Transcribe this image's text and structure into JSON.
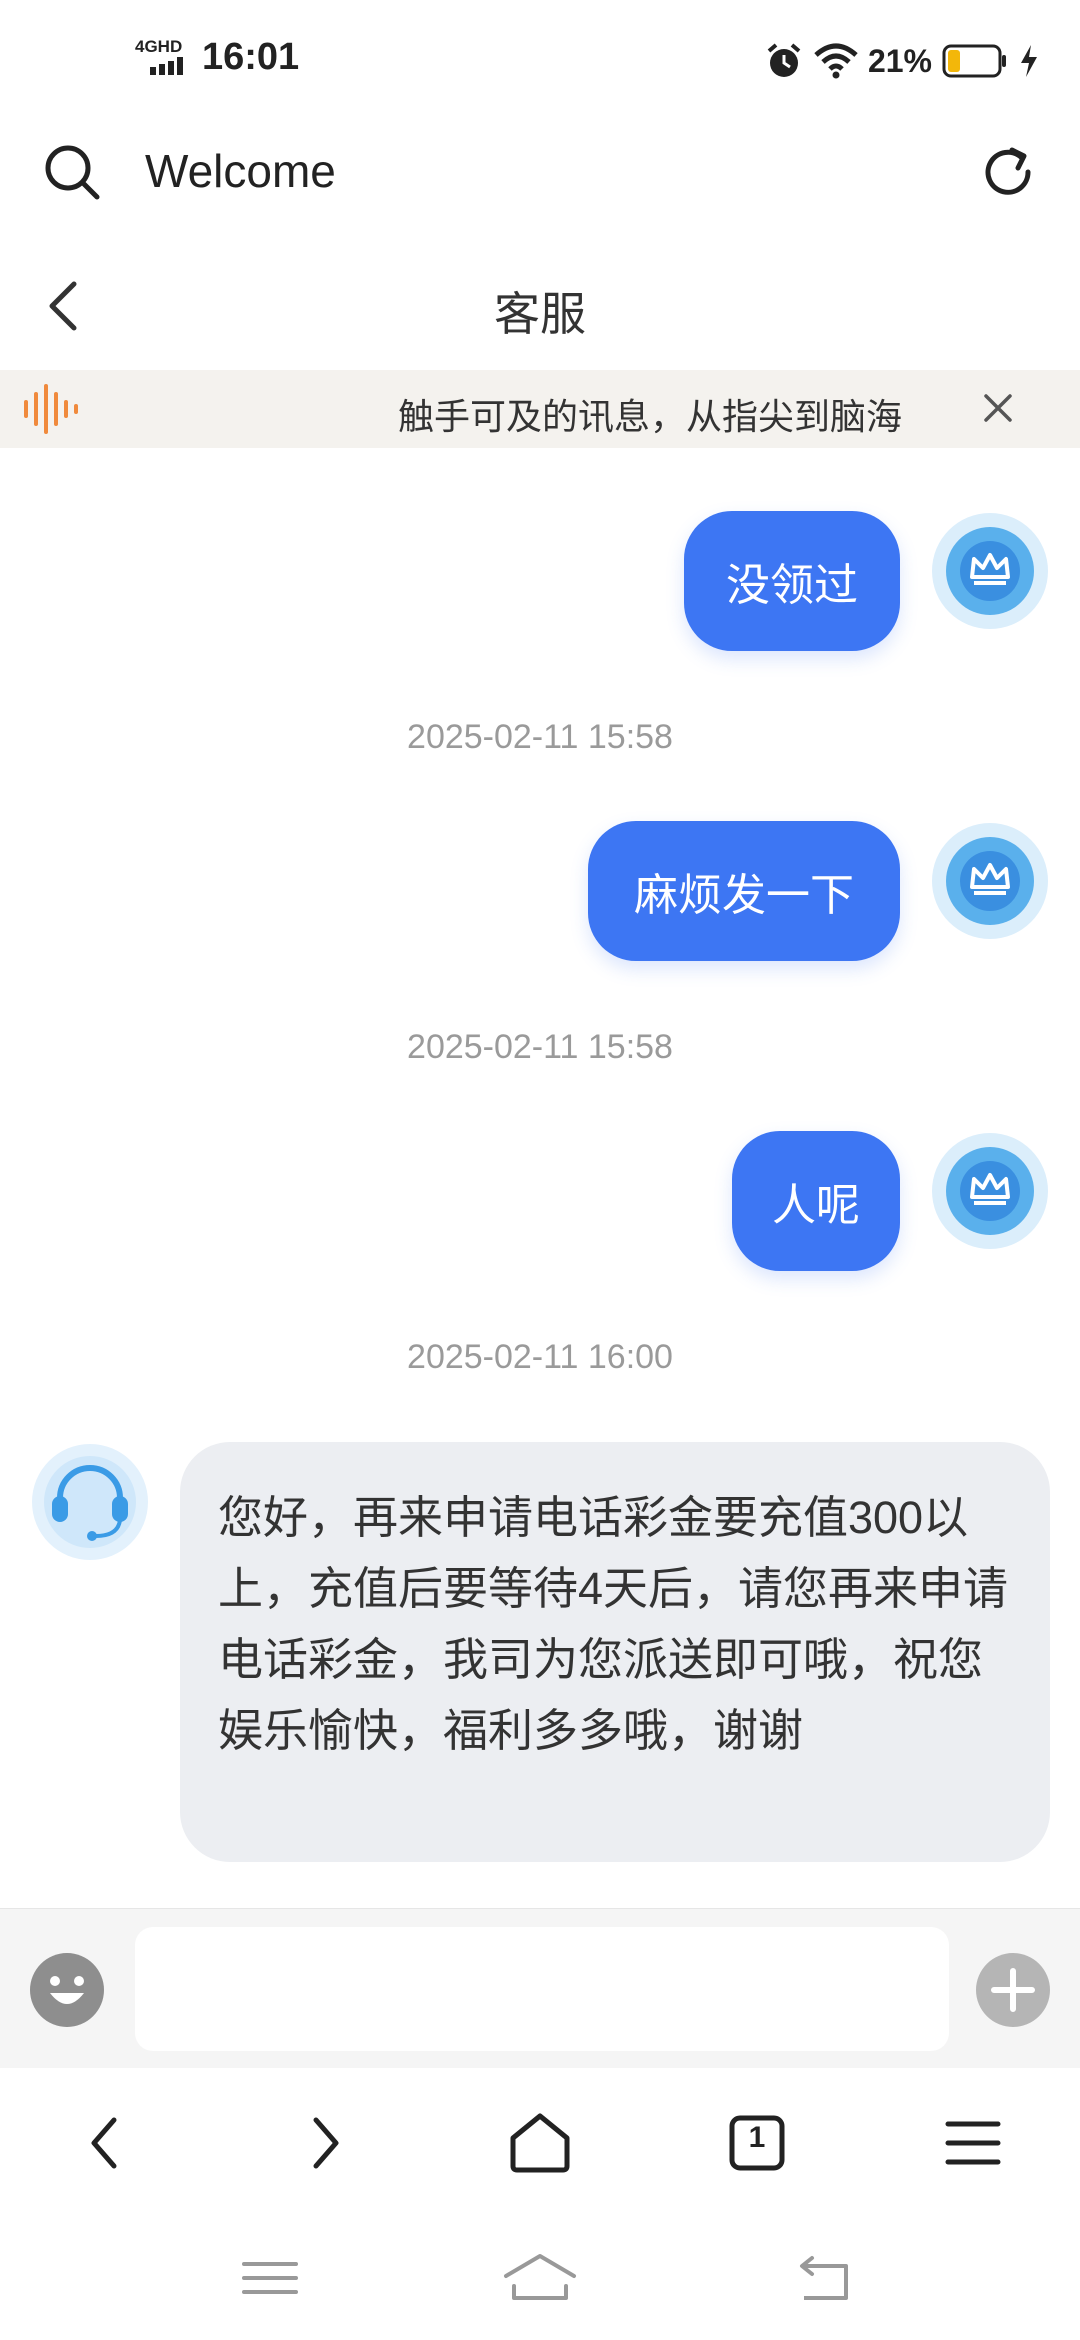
{
  "status_bar": {
    "network": "4GHD",
    "time": "16:01",
    "battery_pct": "21%"
  },
  "browser_bar": {
    "url_text": "Welcome"
  },
  "page_header": {
    "title": "客服"
  },
  "banner": {
    "text": "触手可及的讯息，从指尖到脑海"
  },
  "chat": {
    "messages": [
      {
        "text": "没领过"
      },
      {
        "text": "麻烦发一下"
      },
      {
        "text": "人呢"
      }
    ],
    "timestamps": [
      "2025-02-11 15:58",
      "2025-02-11 15:58",
      "2025-02-11 16:00"
    ],
    "agent_reply": "您好，再来申请电话彩金要充值300以上，充值后要等待4天后，请您再来申请电话彩金，我司为您派送即可哦，祝您娱乐愉快，福利多多哦，谢谢"
  },
  "browser_nav": {
    "tab_count": "1"
  },
  "colors": {
    "bubble_out": "#3d76f3",
    "bubble_in": "#eceef2",
    "banner_bg": "#f4f2ee",
    "banner_icon": "#f08a3c",
    "timestamp": "#9a9a9a"
  }
}
